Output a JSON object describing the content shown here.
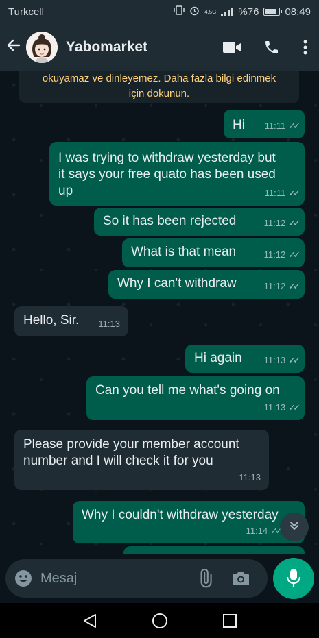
{
  "status_bar": {
    "carrier": "Turkcell",
    "network": "4.5G",
    "battery": "%76",
    "time": "08:49",
    "battery_level": 0.76
  },
  "header": {
    "contact_name": "Yabomarket"
  },
  "encryption_notice": {
    "line1": "okuyamaz ve dinleyemez. Daha fazla bilgi edinmek",
    "line2": "için dokunun."
  },
  "messages": [
    {
      "direction": "out",
      "text": "Hi",
      "time": "11:11"
    },
    {
      "direction": "out",
      "text": "I was trying to withdraw yesterday but it says your free quato has been used up",
      "time": "11:11"
    },
    {
      "direction": "out",
      "text": "So it has been rejected",
      "time": "11:12"
    },
    {
      "direction": "out",
      "text": "What is that mean",
      "time": "11:12"
    },
    {
      "direction": "out",
      "text": "Why I can't withdraw",
      "time": "11:12"
    },
    {
      "direction": "in",
      "text": "Hello, Sir.",
      "time": "11:13"
    },
    {
      "direction": "out",
      "text": "Hi again",
      "time": "11:13"
    },
    {
      "direction": "out",
      "text": "Can you tell me what's going on",
      "time": "11:13"
    },
    {
      "direction": "in",
      "text": "Please provide your member account number and I will check it for you",
      "time": "11:13"
    },
    {
      "direction": "out",
      "text": "Why I couldn't withdraw yesterday",
      "time": "11:14"
    }
  ],
  "composer": {
    "placeholder": "Mesaj"
  },
  "colors": {
    "accent": "#00a884",
    "outgoing_bubble": "#005c4b",
    "incoming_bubble": "#1f2c34",
    "background": "#0b141a",
    "notice_text": "#ffd279"
  },
  "icons": [
    "back-arrow-icon",
    "video-call-icon",
    "phone-icon",
    "more-vert-icon",
    "emoji-icon",
    "attach-icon",
    "camera-icon",
    "mic-icon",
    "chevron-down-icon",
    "nav-back-icon",
    "nav-home-icon",
    "nav-recents-icon"
  ]
}
